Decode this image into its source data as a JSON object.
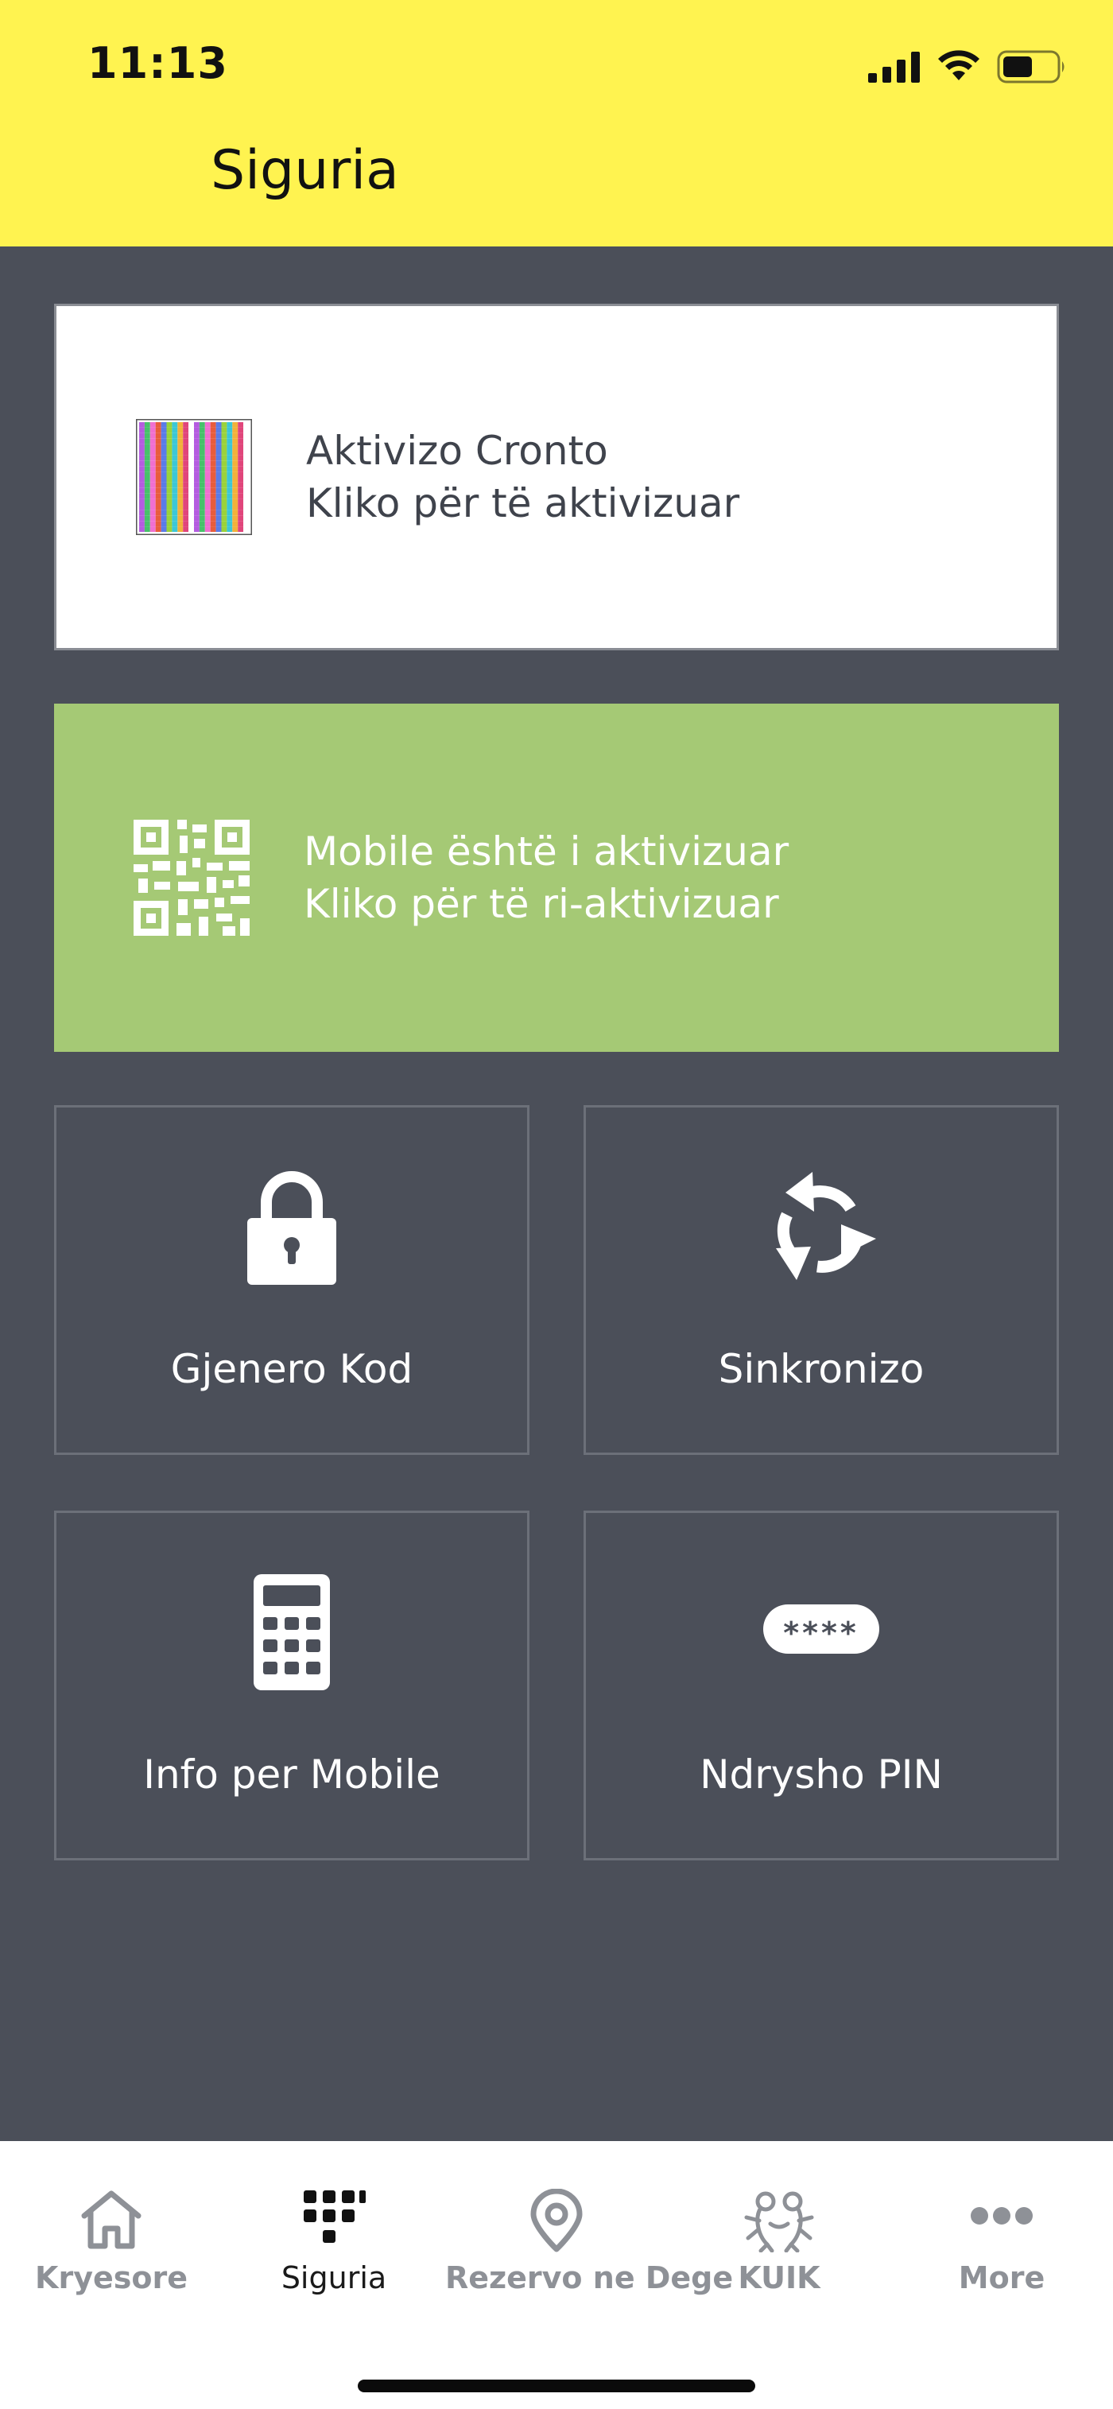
{
  "status_bar": {
    "time": "11:13",
    "icons": [
      "signal-icon",
      "wifi-icon",
      "battery-icon"
    ]
  },
  "header": {
    "title": "Siguria",
    "background": "#fff350"
  },
  "cards": {
    "cronto": {
      "line1": "Aktivizo Cronto",
      "line2": "Kliko për të aktivizuar",
      "icon": "color-qr-icon"
    },
    "mobile": {
      "line1": "Mobile është i aktivizuar",
      "line2": "Kliko për të ri-aktivizuar",
      "icon": "qr-code-icon",
      "background": "#a5c975"
    }
  },
  "tiles": [
    {
      "label": "Gjenero Kod",
      "icon": "lock-icon"
    },
    {
      "label": "Sinkronizo",
      "icon": "sync-icon"
    },
    {
      "label": "Info per Mobile",
      "icon": "calculator-icon"
    },
    {
      "label": "Ndrysho PIN",
      "icon": "pin-icon",
      "pin_mask": "****"
    }
  ],
  "tabbar": {
    "items": [
      {
        "label": "Kryesore",
        "icon": "home-icon",
        "active": false
      },
      {
        "label": "Siguria",
        "icon": "keypad-icon",
        "active": true
      },
      {
        "label": "Rezervo ne Dege",
        "icon": "location-pin-icon",
        "active": false
      },
      {
        "label": "KUIK",
        "icon": "frog-icon",
        "active": false
      },
      {
        "label": "More",
        "icon": "more-icon",
        "active": false
      }
    ]
  },
  "colors": {
    "main_bg": "#4b4f59",
    "tab_inactive": "#8e9197",
    "tab_active": "#1a1a1a"
  }
}
